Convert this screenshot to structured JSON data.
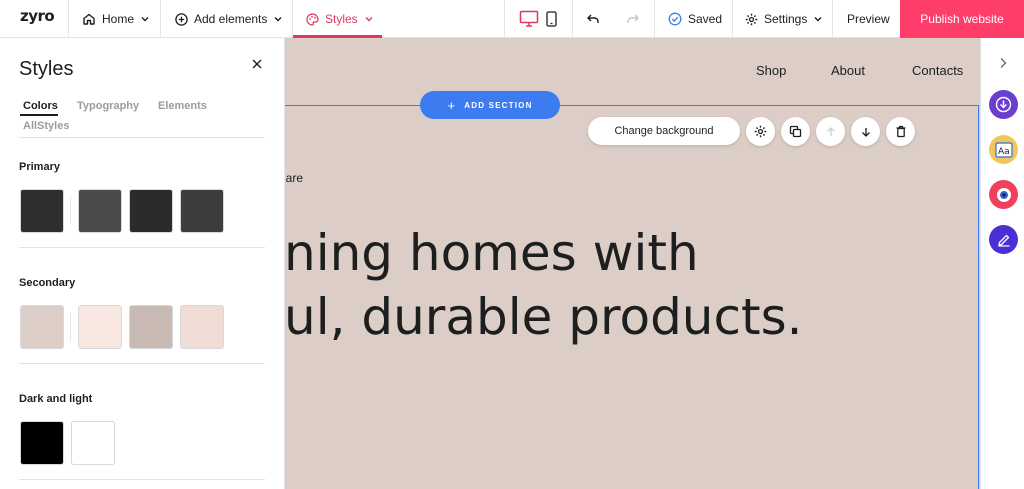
{
  "app": {
    "logo": "zyro"
  },
  "topbar": {
    "page_select": "Home",
    "add_elements": "Add elements",
    "styles": "Styles",
    "saved": "Saved",
    "settings": "Settings",
    "preview": "Preview",
    "publish": "Publish website"
  },
  "panel": {
    "title": "Styles",
    "tabs": [
      "Colors",
      "Typography",
      "Elements",
      "AllStyles"
    ],
    "active_tab": "Colors",
    "sections": {
      "primary": {
        "title": "Primary",
        "colors": [
          "#2e2e2e",
          "#4a4a4a",
          "#2b2b2b",
          "#3d3d3d"
        ]
      },
      "secondary": {
        "title": "Secondary",
        "colors": [
          "#dccdc6",
          "#f8e8e1",
          "#c8bab2",
          "#f0ddd6"
        ]
      },
      "dark_light": {
        "title": "Dark and light",
        "colors": [
          "#000000",
          "#ffffff"
        ]
      }
    }
  },
  "canvas": {
    "nav": [
      "Shop",
      "About",
      "Contacts"
    ],
    "add_section": "ADD SECTION",
    "change_background": "Change background",
    "small_text": "ou are",
    "headline_line1": "ning homes with",
    "headline_line2": "ul, durable products.",
    "background_color": "#dccdc6",
    "selection_color": "#3d7bf0"
  },
  "accent_colors": {
    "styles": "#e2365f",
    "publish": "#ff3d6b",
    "device_active": "#e2365f"
  },
  "rail": {
    "icons": [
      "chevron-right-icon",
      "download-icon",
      "typography-icon",
      "eye-icon",
      "edit-icon"
    ]
  }
}
